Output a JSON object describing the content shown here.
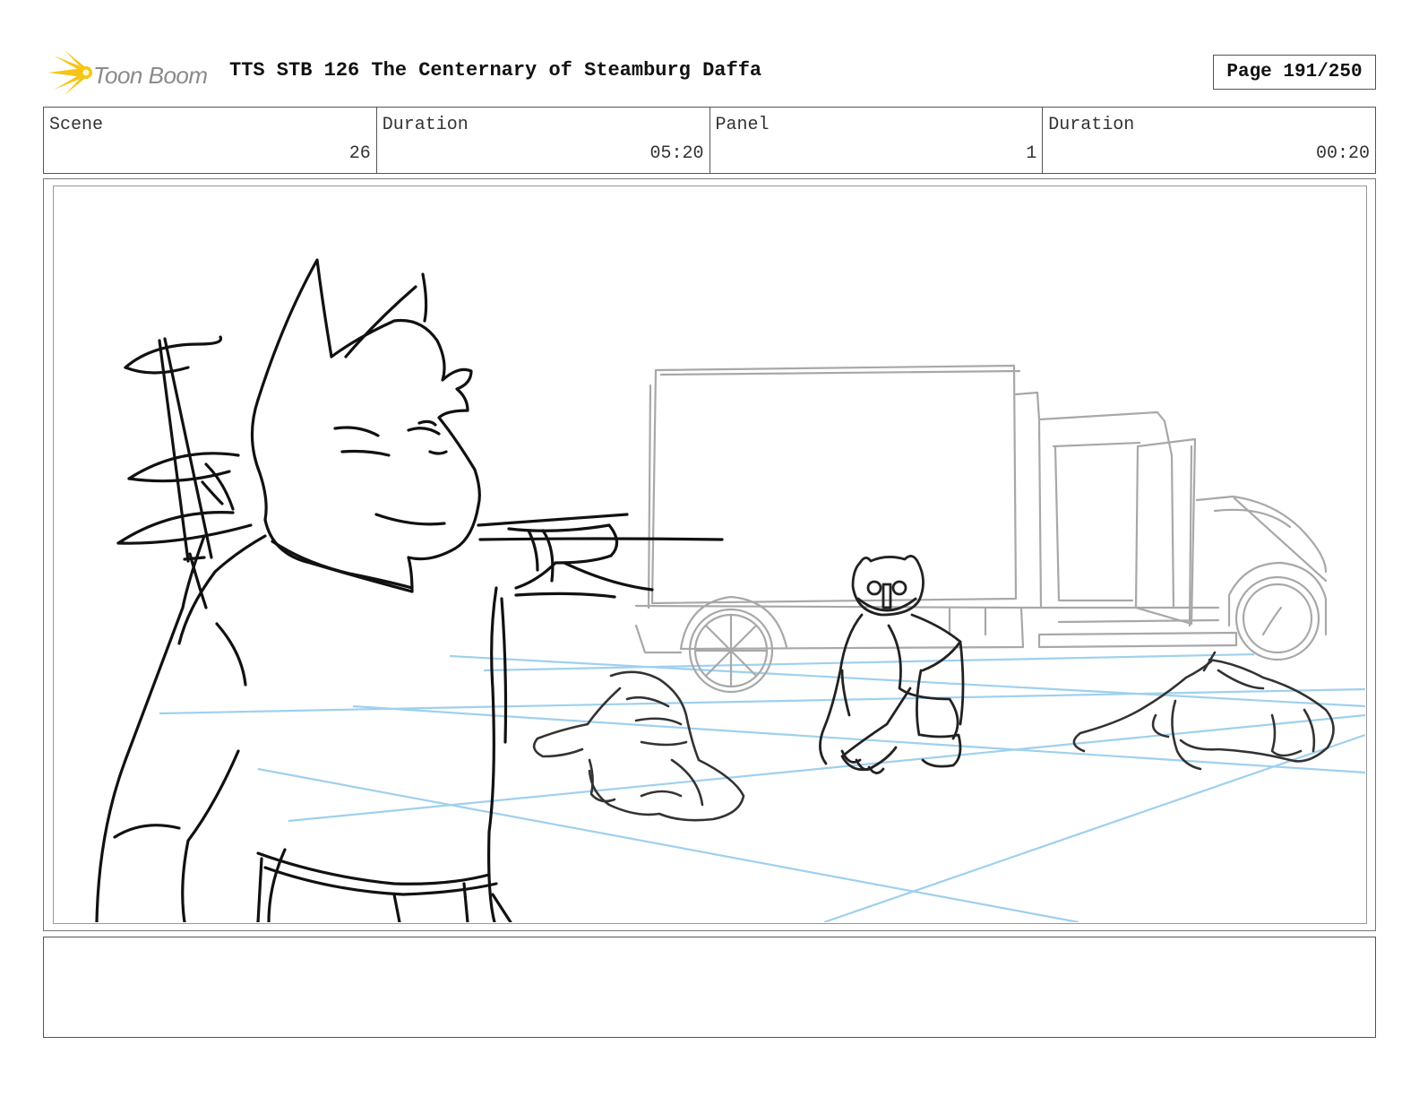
{
  "header": {
    "logo_text": "Toon Boom",
    "title": "TTS STB 126 The Centernary of Steamburg Daffa",
    "page_label": "Page 191/250"
  },
  "info": {
    "scene_label": "Scene",
    "scene_value": "26",
    "scene_duration_label": "Duration",
    "scene_duration_value": "05:20",
    "panel_label": "Panel",
    "panel_value": "1",
    "panel_duration_label": "Duration",
    "panel_duration_value": "00:20"
  },
  "colors": {
    "sketch": "#111111",
    "truck": "#a8a8a8",
    "guides": "#9fd0ee",
    "logo_accent": "#f5c518"
  },
  "notes": {
    "text": ""
  }
}
